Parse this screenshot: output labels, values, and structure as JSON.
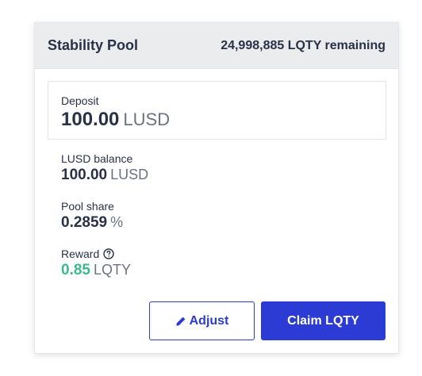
{
  "header": {
    "title": "Stability Pool",
    "remaining": "24,998,885 LQTY remaining"
  },
  "deposit": {
    "label": "Deposit",
    "amount": "100.00",
    "unit": "LUSD"
  },
  "balance": {
    "label": "LUSD balance",
    "amount": "100.00",
    "unit": "LUSD"
  },
  "pool_share": {
    "label": "Pool share",
    "amount": "0.2859",
    "unit": "%"
  },
  "reward": {
    "label": "Reward",
    "amount": "0.85",
    "unit": "LQTY",
    "icon": "question-circle-icon"
  },
  "actions": {
    "adjust_label": "Adjust",
    "adjust_icon": "pencil-icon",
    "claim_label": "Claim LQTY"
  },
  "colors": {
    "primary": "#2b3bd3",
    "reward": "#3dba8b",
    "header_bg": "#eaecee",
    "text": "#293147",
    "muted": "#6b7280"
  }
}
